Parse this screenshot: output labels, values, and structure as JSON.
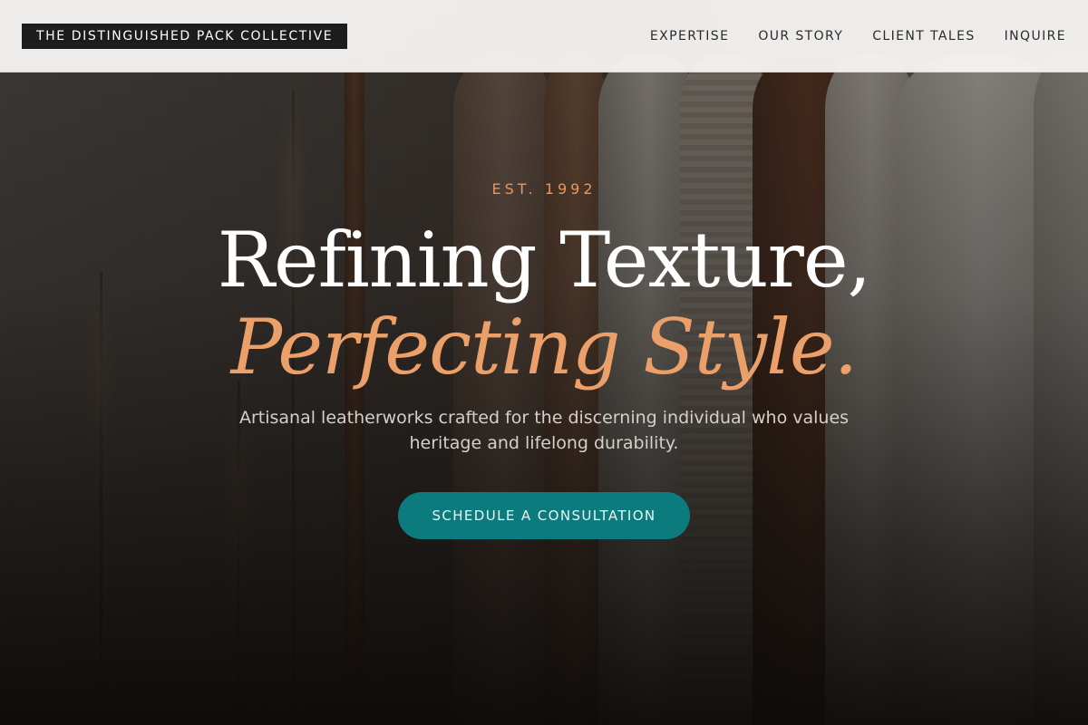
{
  "brand": {
    "name": "THE DISTINGUISHED PACK COLLECTIVE"
  },
  "nav": {
    "items": [
      {
        "label": "EXPERTISE"
      },
      {
        "label": "OUR STORY"
      },
      {
        "label": "CLIENT TALES"
      },
      {
        "label": "INQUIRE"
      }
    ]
  },
  "hero": {
    "eyebrow": "EST. 1992",
    "headline_line1": "Refining Texture,",
    "headline_line2": "Perfecting Style.",
    "subtext": "Artisanal leatherworks crafted for the discerning individual who values heritage and lifelong durability.",
    "cta_label": "SCHEDULE A CONSULTATION"
  },
  "colors": {
    "accent": "#eba06a",
    "cta": "#0b7b7d",
    "header_bg": "#f5f4f3",
    "logo_bg": "#1c1c1c"
  }
}
